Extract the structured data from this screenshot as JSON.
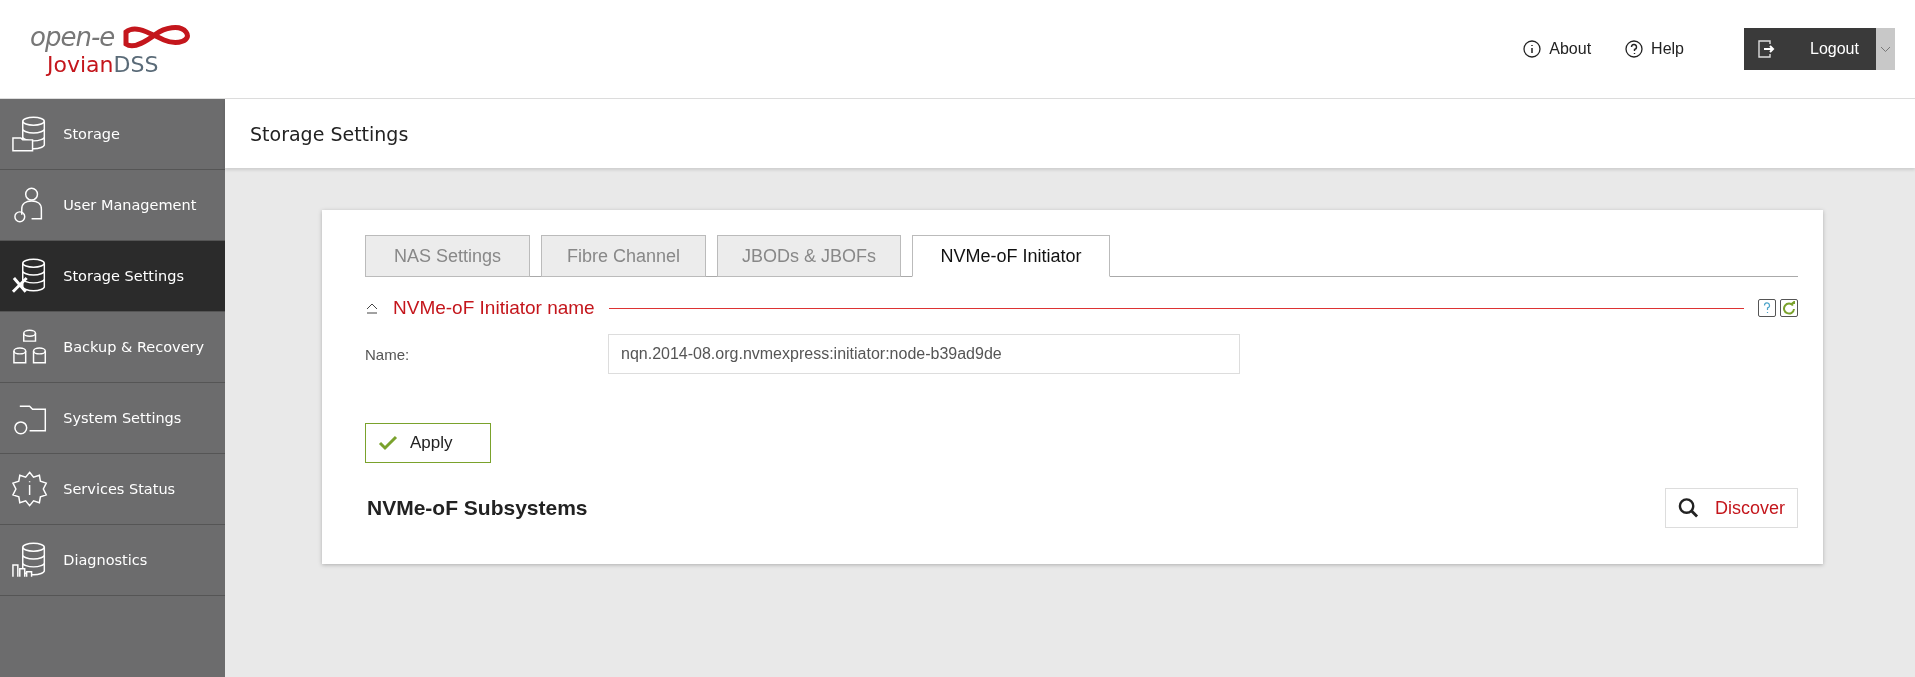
{
  "logo": {
    "brand": "open-e",
    "product_main": "Jovian",
    "product_suffix": "DSS"
  },
  "header_links": [
    {
      "kind": "info",
      "label": "About"
    },
    {
      "kind": "help",
      "label": "Help"
    }
  ],
  "logout": {
    "label": "Logout"
  },
  "sidebar": {
    "items": [
      {
        "kind": "storage",
        "label": "Storage",
        "selected": false
      },
      {
        "kind": "user",
        "label": "User Management",
        "selected": false
      },
      {
        "kind": "tools",
        "label": "Storage Settings",
        "selected": true
      },
      {
        "kind": "backup",
        "label": "Backup & Recovery",
        "selected": false
      },
      {
        "kind": "system",
        "label": "System Settings",
        "selected": false
      },
      {
        "kind": "services",
        "label": "Services Status",
        "selected": false
      },
      {
        "kind": "diagnostics",
        "label": "Diagnostics",
        "selected": false
      }
    ]
  },
  "page_title": "Storage Settings",
  "tabs": [
    {
      "label": "NAS Settings",
      "selected": false
    },
    {
      "label": "Fibre Channel",
      "selected": false
    },
    {
      "label": "JBODs & JBOFs",
      "selected": false
    },
    {
      "label": "NVMe-oF Initiator",
      "selected": true
    }
  ],
  "section": {
    "title": "NVMe-oF Initiator name",
    "expanded": true,
    "fields": [
      {
        "label": "Name:",
        "value": "nqn.2014-08.org.nvmexpress:initiator:node-b39ad9de"
      }
    ],
    "apply_label": "Apply"
  },
  "subsystems": {
    "title": "NVMe-oF Subsystems",
    "discover_label": "Discover"
  }
}
